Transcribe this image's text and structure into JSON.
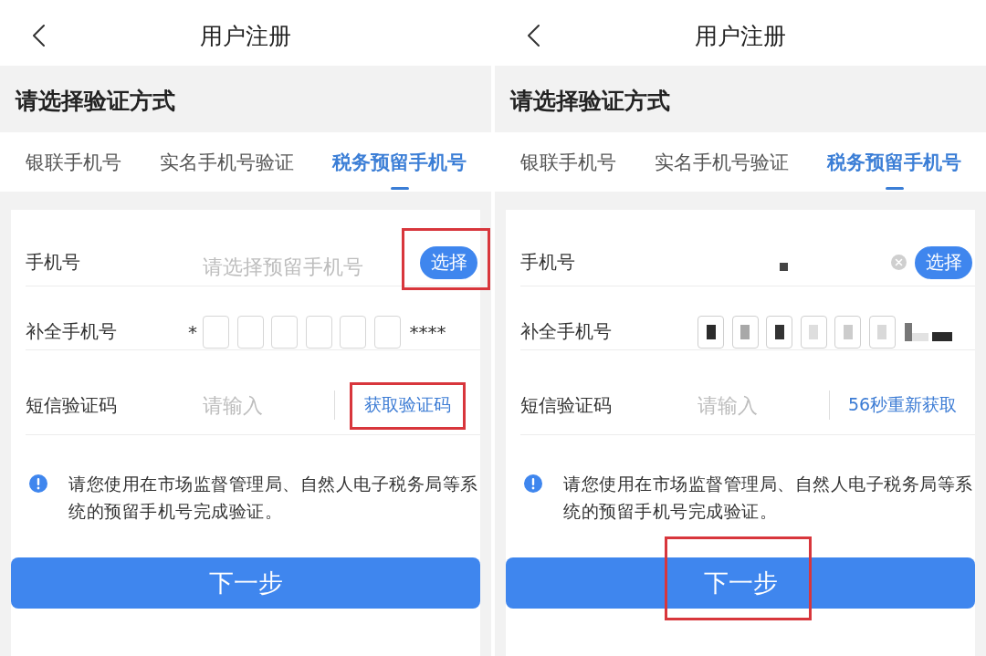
{
  "panels": [
    {
      "title": "用户注册",
      "section_title": "请选择验证方式",
      "tabs": [
        {
          "label": "银联手机号",
          "selected": false
        },
        {
          "label": "实名手机号验证",
          "selected": false
        },
        {
          "label": "税务预留手机号",
          "selected": true
        }
      ],
      "form": {
        "phone": {
          "label": "手机号",
          "placeholder": "请选择预留手机号",
          "select_button": {
            "label": "选择",
            "highlighted": true
          }
        },
        "complete_number": {
          "label": "补全手机号",
          "prefix": "*",
          "digits": [
            {
              "filled": false
            },
            {
              "filled": false
            },
            {
              "filled": false
            },
            {
              "filled": false
            },
            {
              "filled": false
            },
            {
              "filled": false
            }
          ],
          "suffix": "****"
        },
        "sms_code": {
          "label": "短信验证码",
          "placeholder": "请输入",
          "action": {
            "label": "获取验证码",
            "highlighted": true
          }
        }
      },
      "notice": "请您使用在市场监督管理局、自然人电子税务局等系统的预留手机号完成验证。",
      "next_button": {
        "label": "下一步",
        "highlighted": false
      }
    },
    {
      "title": "用户注册",
      "section_title": "请选择验证方式",
      "tabs": [
        {
          "label": "银联手机号",
          "selected": false
        },
        {
          "label": "实名手机号验证",
          "selected": false
        },
        {
          "label": "税务预留手机号",
          "selected": true
        }
      ],
      "form": {
        "phone": {
          "label": "手机号",
          "value_redacted": true,
          "clear_button": true,
          "select_button": {
            "label": "选择",
            "highlighted": false
          }
        },
        "complete_number": {
          "label": "补全手机号",
          "digits": [
            {
              "filled": true
            },
            {
              "filled": true
            },
            {
              "filled": true
            },
            {
              "filled": true
            },
            {
              "filled": true
            },
            {
              "filled": true
            }
          ],
          "suffix_redacted": true
        },
        "sms_code": {
          "label": "短信验证码",
          "placeholder": "请输入",
          "action": {
            "label": "56秒重新获取",
            "highlighted": false
          }
        }
      },
      "notice": "请您使用在市场监督管理局、自然人电子税务局等系统的预留手机号完成验证。",
      "next_button": {
        "label": "下一步",
        "highlighted": true
      }
    }
  ]
}
